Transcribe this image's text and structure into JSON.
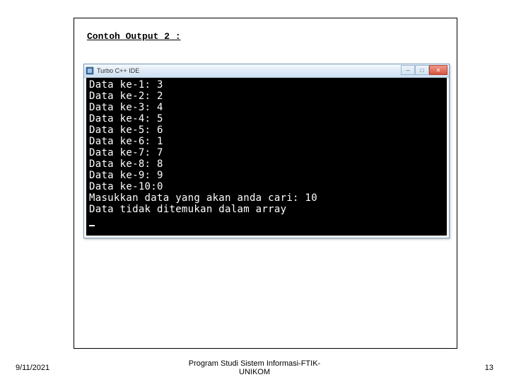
{
  "slide": {
    "section_title": "Contoh Output 2 :"
  },
  "window": {
    "title": "Turbo C++ IDE",
    "min_label": "–",
    "max_label": "□",
    "close_label": "✕"
  },
  "console": {
    "lines": [
      "Data ke-1: 3",
      "Data ke-2: 2",
      "Data ke-3: 4",
      "Data ke-4: 5",
      "Data ke-5: 6",
      "Data ke-6: 1",
      "Data ke-7: 7",
      "Data ke-8: 8",
      "Data ke-9: 9",
      "Data ke-10:0",
      "Masukkan data yang akan anda cari: 10",
      "Data tidak ditemukan dalam array"
    ]
  },
  "footer": {
    "date": "9/11/2021",
    "center_line1": "Program Studi Sistem Informasi-FTIK-",
    "center_line2": "UNIKOM",
    "page": "13"
  }
}
